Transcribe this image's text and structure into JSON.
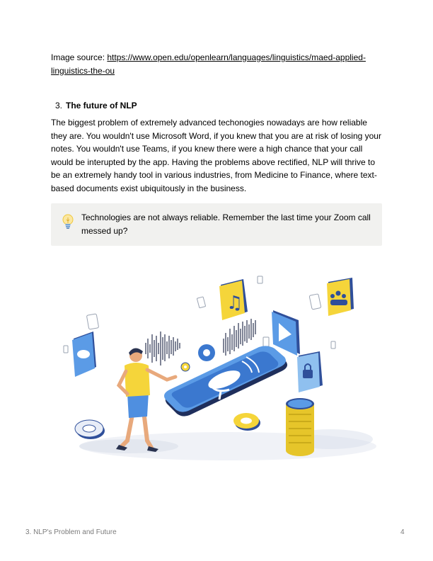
{
  "source": {
    "label": "Image source: ",
    "url": "https://www.open.edu/openlearn/languages/linguistics/maed-applied-linguistics-the-ou"
  },
  "section": {
    "number": "3.",
    "title": "The future of NLP"
  },
  "paragraph": "The biggest problem of extremely advanced techonogies nowadays are how reliable they are. You wouldn't use Microsoft Word, if you knew that you are at risk of losing your notes. You wouldn't use Teams, if you knew there were a high chance that your call would be interupted by the app. Having the problems above rectified, NLP will thrive to be an extremely handy tool in various industries, from Medicine to Finance, where text-based documents exist ubiquitously in the business.",
  "callout": {
    "icon": "lightbulb-icon",
    "text": "Technologies are not always reliable. Remember the last time your Zoom call messed up?"
  },
  "illustration": {
    "description_icon": "voice-assistant-illustration",
    "colors": {
      "blue": "#2f5aa8",
      "light_blue": "#5b9be6",
      "yellow": "#f5d53a",
      "skin": "#e8a97c"
    }
  },
  "footer": {
    "title": "3. NLP's Problem and Future",
    "page": "4"
  }
}
